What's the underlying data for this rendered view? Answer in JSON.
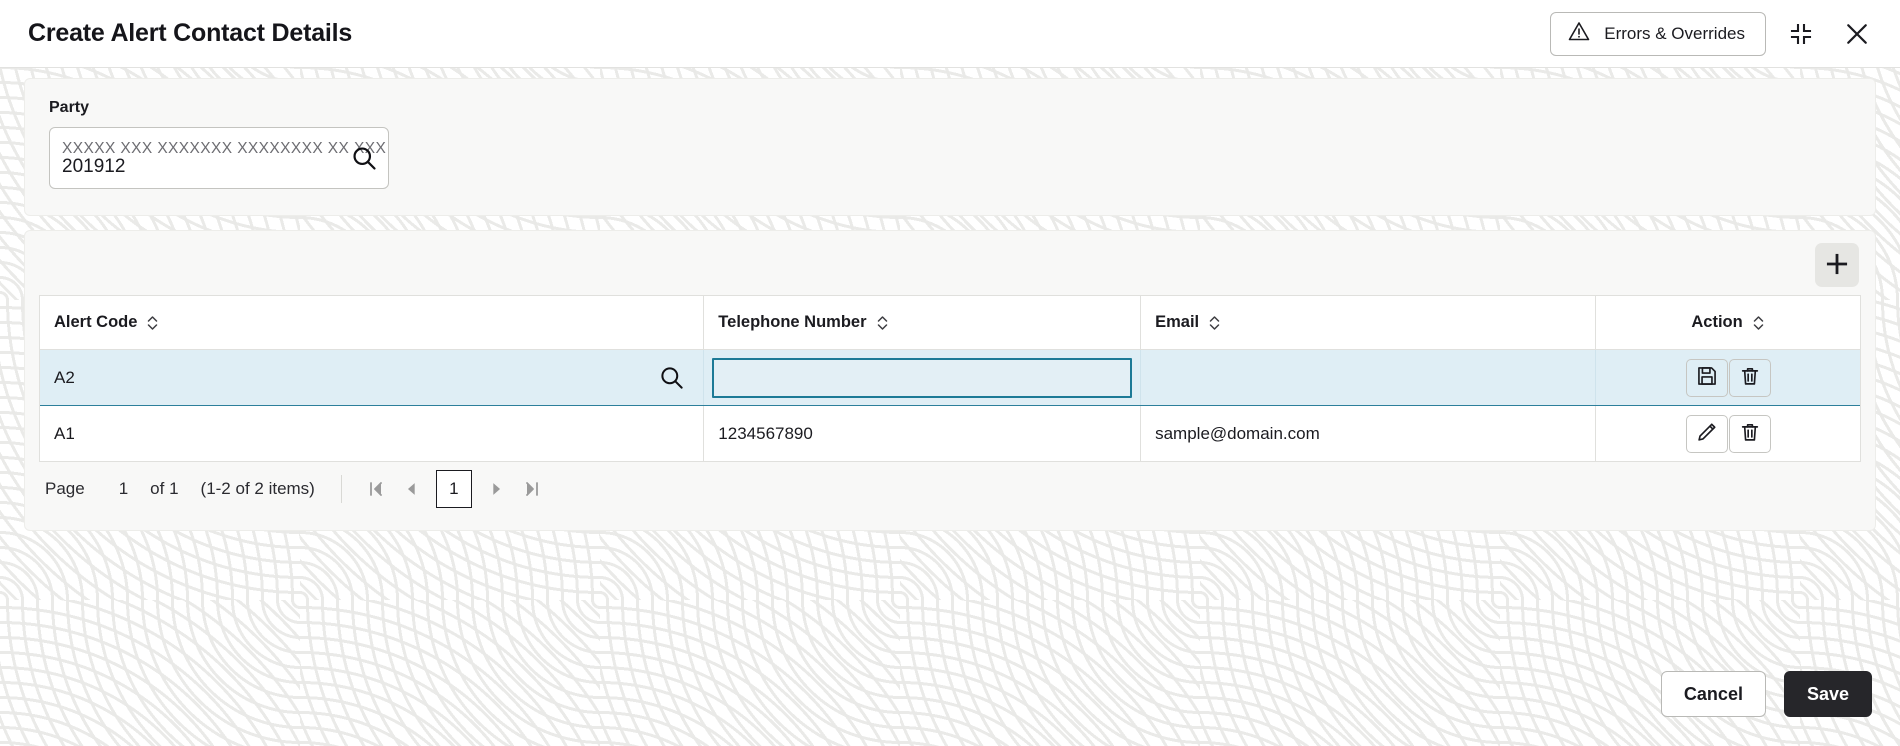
{
  "header": {
    "title": "Create Alert Contact Details",
    "errors_button": "Errors & Overrides",
    "warning_icon": "warning-triangle-icon",
    "minimize_icon": "collapse-icon",
    "close_icon": "close-icon"
  },
  "party": {
    "label": "Party",
    "masked_text": "XXXXX XXX XXXXXXX XXXXXXXX XX XXX",
    "value": "201912",
    "search_icon": "search-icon"
  },
  "table": {
    "add_icon": "plus-icon",
    "columns": [
      {
        "label": "Alert Code",
        "sort_icon": "sort-icon"
      },
      {
        "label": "Telephone Number",
        "sort_icon": "sort-icon"
      },
      {
        "label": "Email",
        "sort_icon": "sort-icon"
      },
      {
        "label": "Action",
        "sort_icon": "sort-icon"
      }
    ],
    "rows": [
      {
        "alert_code": "A2",
        "telephone": "",
        "email": "",
        "selected": true,
        "editing": true,
        "alert_code_search_icon": "search-icon",
        "actions": [
          {
            "name": "save-row-button",
            "icon": "floppy-disk-icon"
          },
          {
            "name": "delete-row-button",
            "icon": "trash-icon"
          }
        ]
      },
      {
        "alert_code": "A1",
        "telephone": "1234567890",
        "email": "sample@domain.com",
        "selected": false,
        "editing": false,
        "actions": [
          {
            "name": "edit-row-button",
            "icon": "pencil-icon"
          },
          {
            "name": "delete-row-button",
            "icon": "trash-icon"
          }
        ]
      }
    ]
  },
  "pagination": {
    "page_label": "Page",
    "current_page": "1",
    "of_label": "of 1",
    "items_label": "(1-2 of 2 items)",
    "first_icon": "first-page-icon",
    "prev_icon": "previous-page-icon",
    "active_page": "1",
    "next_icon": "next-page-icon",
    "last_icon": "last-page-icon"
  },
  "footer": {
    "cancel_label": "Cancel",
    "save_label": "Save"
  },
  "colors": {
    "accent_focus": "#1d7a96",
    "selected_row": "#dfeef5",
    "save_button": "#26262a",
    "panel_bg": "#f8f8f7"
  }
}
